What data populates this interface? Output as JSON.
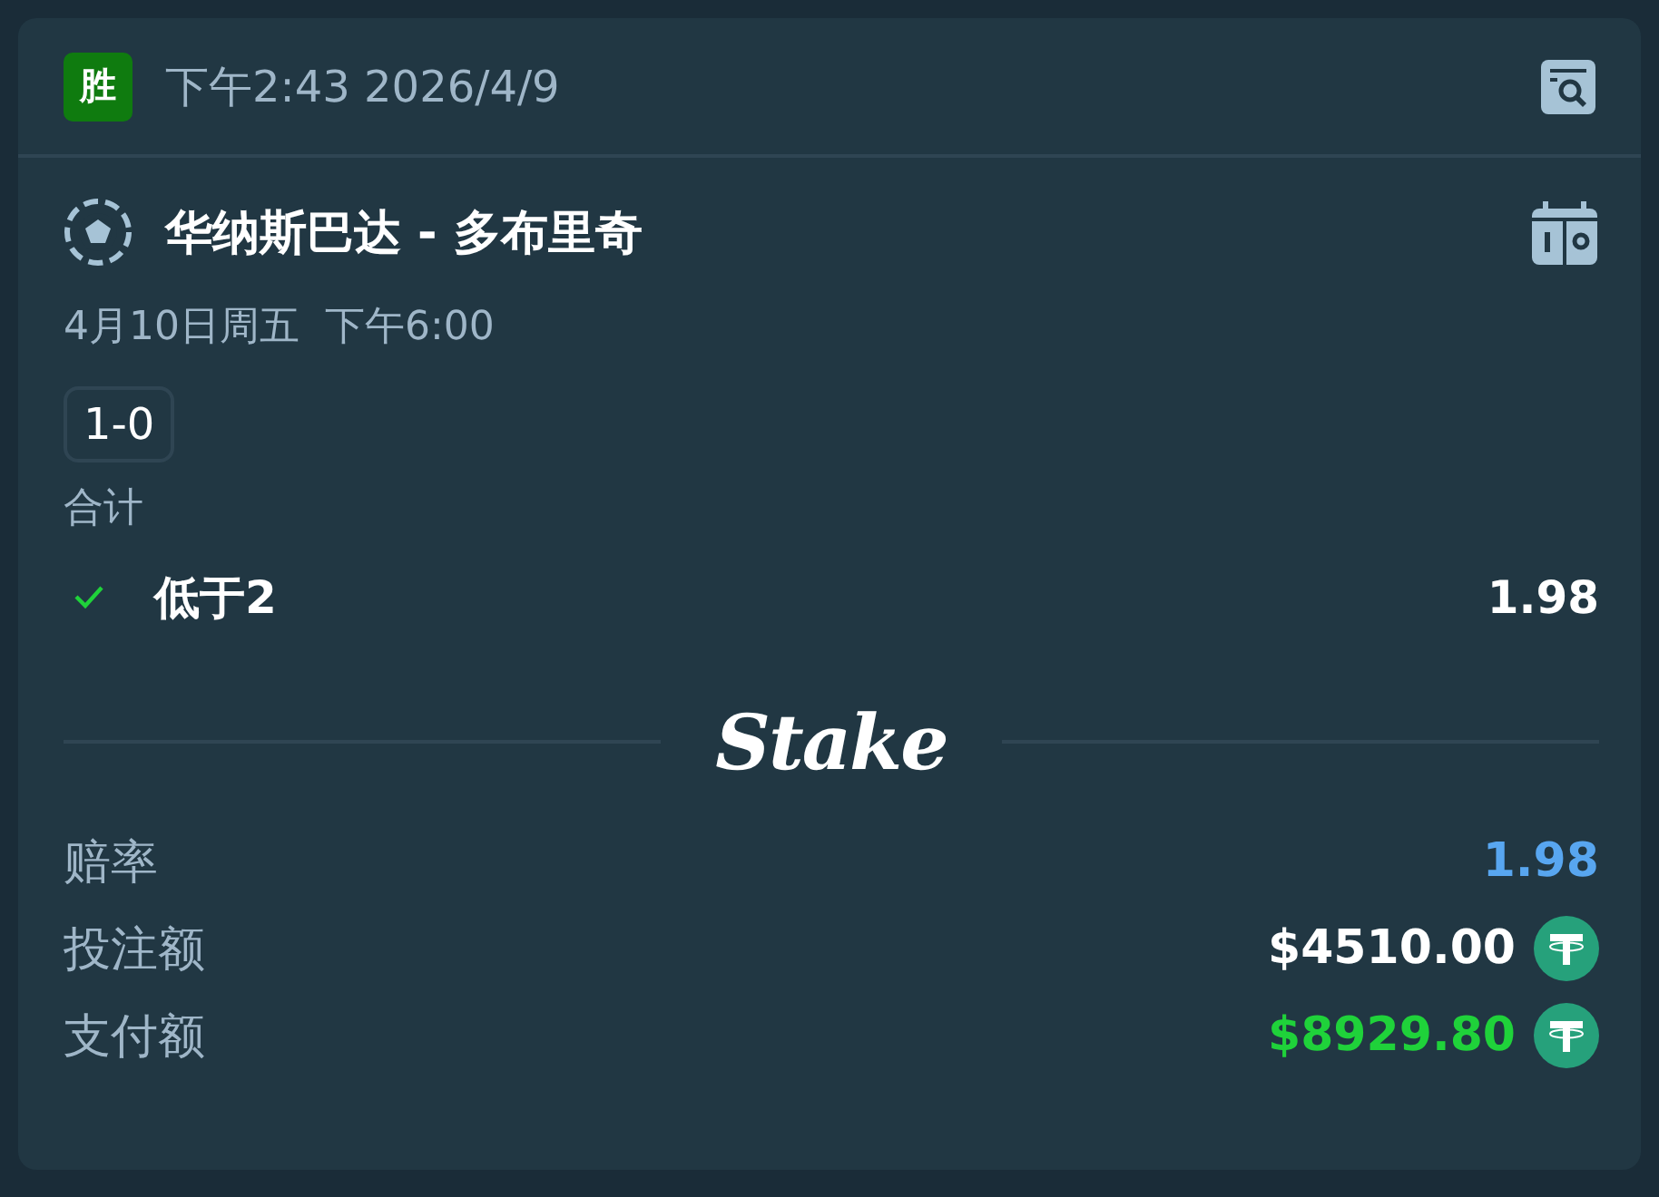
{
  "header": {
    "result": {
      "label": "胜",
      "kind": "win"
    },
    "placed_at": "下午2:43 2026/4/9"
  },
  "event": {
    "title": "华纳斯巴达 - 多布里奇",
    "start": "4月10日周五  下午6:00",
    "score": "1-0"
  },
  "market": {
    "name": "合计",
    "selection": {
      "label": "低于2",
      "won": true,
      "odds": "1.98"
    }
  },
  "brand": {
    "logo": "Stake"
  },
  "summary": [
    {
      "kind": "odds",
      "label": "赔率",
      "value": "1.98"
    },
    {
      "kind": "stake",
      "label": "投注额",
      "value": "$4510.00"
    },
    {
      "kind": "payout",
      "label": "支付额",
      "value": "$8929.80"
    }
  ]
}
